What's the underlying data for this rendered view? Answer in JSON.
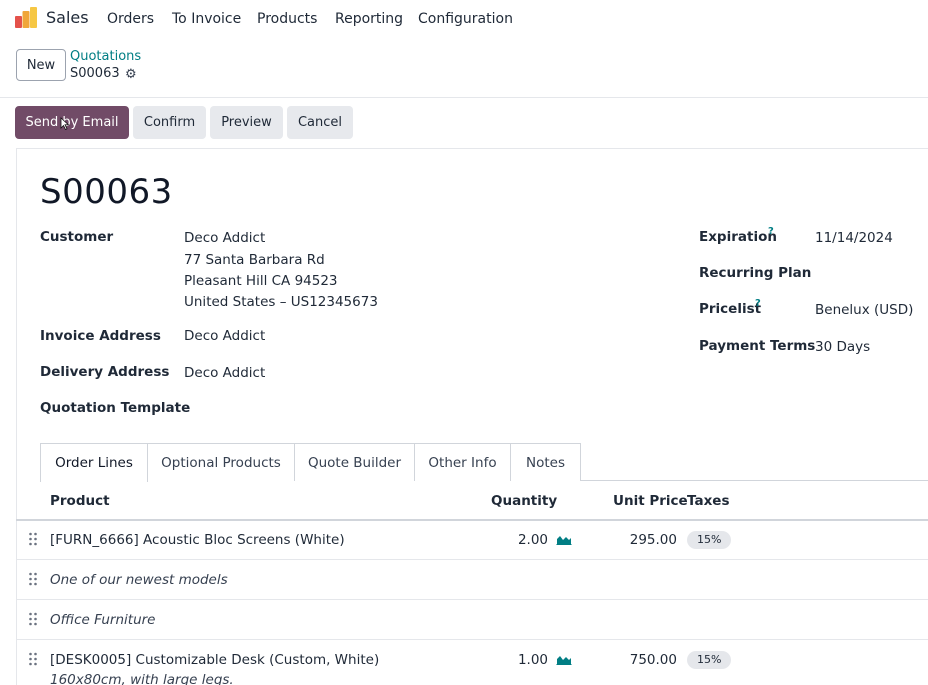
{
  "nav": {
    "app_name": "Sales",
    "logo_icon": "sales-app-logo",
    "items": [
      "Orders",
      "To Invoice",
      "Products",
      "Reporting",
      "Configuration"
    ]
  },
  "control_panel": {
    "new_label": "New",
    "breadcrumb_parent": "Quotations",
    "breadcrumb_current": "S00063",
    "gear_icon": "gear-icon"
  },
  "statusbar": {
    "send_label": "Send by Email",
    "confirm_label": "Confirm",
    "preview_label": "Preview",
    "cancel_label": "Cancel"
  },
  "form": {
    "title": "S00063",
    "customer_label": "Customer",
    "customer_name": "Deco Addict",
    "customer_street": "77 Santa Barbara Rd",
    "customer_city": "Pleasant Hill CA 94523",
    "customer_country": "United States – US12345673",
    "invoice_address_label": "Invoice Address",
    "invoice_address_value": "Deco Addict",
    "delivery_address_label": "Delivery Address",
    "delivery_address_value": "Deco Addict",
    "quotation_template_label": "Quotation Template",
    "expiration_label": "Expiration",
    "expiration_value": "11/14/2024",
    "recurring_plan_label": "Recurring Plan",
    "pricelist_label": "Pricelist",
    "pricelist_value": "Benelux (USD)",
    "payment_terms_label": "Payment Terms",
    "payment_terms_value": "30 Days",
    "help_mark": "?"
  },
  "tabs": [
    "Order Lines",
    "Optional Products",
    "Quote Builder",
    "Other Info",
    "Notes"
  ],
  "order_lines": {
    "headers": {
      "product": "Product",
      "quantity": "Quantity",
      "unit_price": "Unit Price",
      "taxes": "Taxes"
    },
    "rows": [
      {
        "type": "product",
        "product": "[FURN_6666] Acoustic Bloc Screens (White)",
        "quantity": "2.00",
        "unit_price": "295.00",
        "tax": "15%"
      },
      {
        "type": "note",
        "text": "One of our newest models"
      },
      {
        "type": "section",
        "text": "Office Furniture"
      },
      {
        "type": "product",
        "product": "[DESK0005] Customizable Desk (Custom, White)",
        "description": "160x80cm, with large legs.",
        "quantity": "1.00",
        "unit_price": "750.00",
        "tax": "15%"
      }
    ]
  },
  "colors": {
    "primary": "#714b67",
    "link": "#017e84"
  }
}
